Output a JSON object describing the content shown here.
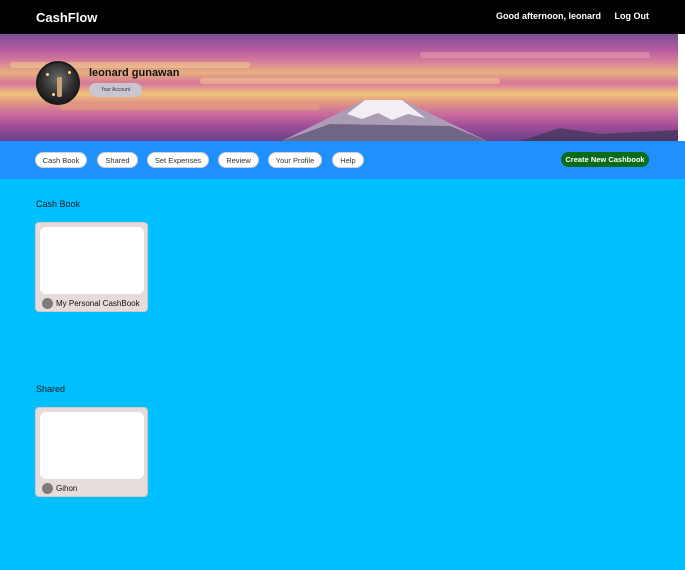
{
  "header": {
    "brand": "CashFlow",
    "greeting": "Good afternoon, leonard",
    "logout_label": "Log Out"
  },
  "profile": {
    "name": "leonard gunawan",
    "account_button_label": "Your Account"
  },
  "nav": {
    "tabs": [
      {
        "label": "Cash Book"
      },
      {
        "label": "Shared"
      },
      {
        "label": "Set Expenses"
      },
      {
        "label": "Review"
      },
      {
        "label": "Your Profile"
      },
      {
        "label": "Help"
      }
    ],
    "create_label": "Create New Cashbook"
  },
  "sections": {
    "cashbook": {
      "title": "Cash Book",
      "cards": [
        {
          "label": "My Personal CashBook"
        }
      ]
    },
    "shared": {
      "title": "Shared",
      "cards": [
        {
          "label": "Gihon"
        }
      ]
    }
  },
  "colors": {
    "topbar": "#000000",
    "nav": "#1e90ff",
    "page_background": "#00bfff",
    "create_button": "#0a6b1b",
    "card": "#e6dcdc"
  }
}
